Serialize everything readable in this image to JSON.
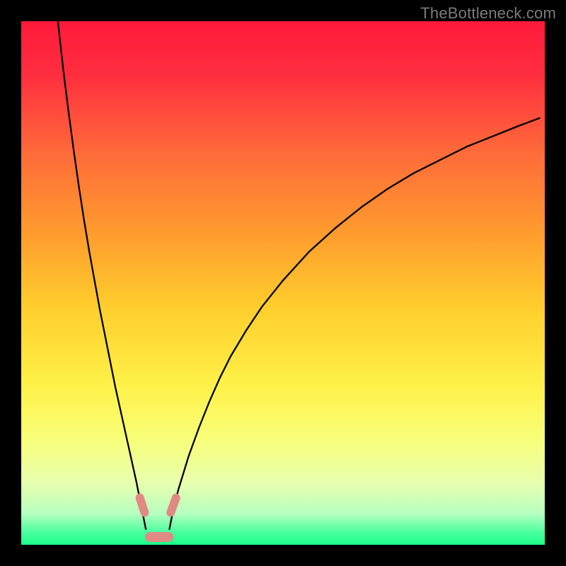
{
  "watermark": {
    "text": "TheBottleneck.com"
  },
  "chart_data": {
    "type": "line",
    "title": "",
    "xlabel": "",
    "ylabel": "",
    "xlim": [
      0,
      100
    ],
    "ylim": [
      0,
      100
    ],
    "grid": false,
    "background_gradient": {
      "stops": [
        {
          "offset": 0.0,
          "color": "#ff1a3a"
        },
        {
          "offset": 0.1,
          "color": "#ff2d3f"
        },
        {
          "offset": 0.25,
          "color": "#ff6a3a"
        },
        {
          "offset": 0.4,
          "color": "#ff9a2e"
        },
        {
          "offset": 0.55,
          "color": "#ffcf2d"
        },
        {
          "offset": 0.7,
          "color": "#fff24a"
        },
        {
          "offset": 0.8,
          "color": "#f8ff7a"
        },
        {
          "offset": 0.88,
          "color": "#e8ffae"
        },
        {
          "offset": 0.94,
          "color": "#b8ffc0"
        },
        {
          "offset": 0.975,
          "color": "#4dffa0"
        },
        {
          "offset": 1.0,
          "color": "#1aff85"
        }
      ]
    },
    "series": [
      {
        "name": "left-branch",
        "color": "#000000",
        "x": [
          7,
          8,
          9,
          10,
          11,
          12,
          13,
          14,
          15,
          16,
          17,
          18,
          19,
          20,
          21,
          22,
          23,
          23.8
        ],
        "y": [
          100,
          91,
          83,
          75.5,
          68.5,
          62,
          56,
          50.5,
          45,
          40,
          35,
          30,
          25.5,
          21,
          16.5,
          12,
          7,
          3
        ]
      },
      {
        "name": "right-branch",
        "color": "#000000",
        "x": [
          28.3,
          29,
          30,
          32,
          34,
          36,
          38,
          40,
          43,
          46,
          50,
          55,
          60,
          65,
          70,
          75,
          80,
          85,
          90,
          95,
          99
        ],
        "y": [
          3,
          6.5,
          10.5,
          17,
          22.5,
          27.5,
          32,
          36,
          41,
          45.5,
          50.5,
          56,
          60.5,
          64.5,
          68,
          71,
          73.5,
          76,
          78,
          80,
          81.5
        ]
      },
      {
        "name": "baseline",
        "color": "#1aff85",
        "x": [
          0,
          100
        ],
        "y": [
          0,
          0
        ]
      }
    ],
    "markers": [
      {
        "name": "marker-upper-left",
        "cx": 23.1,
        "cy": 7.6,
        "w": 1.6,
        "h": 4.6,
        "rot": -18
      },
      {
        "name": "marker-upper-right",
        "cx": 29.0,
        "cy": 7.6,
        "w": 1.6,
        "h": 4.6,
        "rot": 20
      },
      {
        "name": "marker-bottom",
        "cx": 26.4,
        "cy": 1.5,
        "w": 5.4,
        "h": 1.8,
        "rot": 0
      }
    ],
    "optimal_x_range": [
      23.8,
      28.3
    ]
  }
}
